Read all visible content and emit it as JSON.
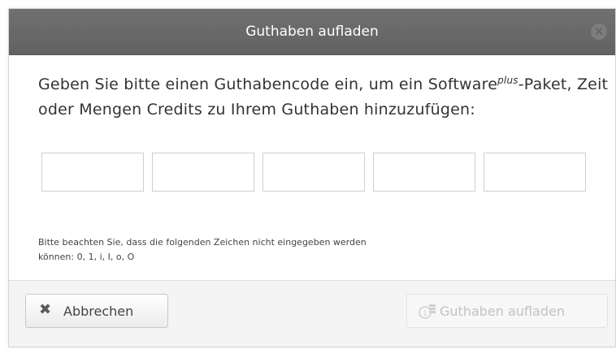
{
  "dialog": {
    "title": "Guthaben aufladen",
    "close_glyph": "✕",
    "intro_part1": "Geben Sie bitte einen Guthabencode ein, um ein Software",
    "intro_sup": "plus",
    "intro_part2": "-Paket, Zeit oder Mengen Credits zu Ihrem Guthaben hinzuzufügen:",
    "code_fields": [
      {
        "value": "",
        "placeholder": ""
      },
      {
        "value": "",
        "placeholder": ""
      },
      {
        "value": "",
        "placeholder": ""
      },
      {
        "value": "",
        "placeholder": ""
      },
      {
        "value": "",
        "placeholder": ""
      }
    ],
    "note_line1": "Bitte beachten Sie, dass die folgenden Zeichen nicht eingegeben werden",
    "note_line2": "können: 0, 1, i, I, o, O"
  },
  "footer": {
    "cancel_label": "Abbrechen",
    "cancel_icon": "x-icon",
    "charge_label": "Guthaben aufladen",
    "charge_icon": "coins-icon",
    "charge_disabled": true
  },
  "colors": {
    "titlebar": "#666666",
    "text": "#333333",
    "disabled_text": "#c2c2c2"
  }
}
